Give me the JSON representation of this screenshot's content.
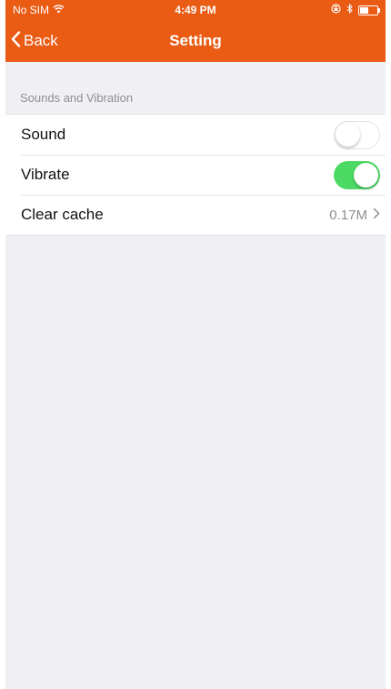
{
  "status_bar": {
    "carrier": "No SIM",
    "time": "4:49 PM",
    "icons": [
      "wifi-icon",
      "orientation-lock-icon",
      "bluetooth-icon",
      "battery-icon"
    ]
  },
  "nav": {
    "back_label": "Back",
    "title": "Setting"
  },
  "section": {
    "header": "Sounds and Vibration"
  },
  "rows": [
    {
      "label": "Sound",
      "toggle_on": false
    },
    {
      "label": "Vibrate",
      "toggle_on": true
    },
    {
      "label": "Clear cache",
      "value": "0.17M"
    }
  ],
  "colors": {
    "brand": "#ea5b14",
    "toggle_on": "#4cd964",
    "background": "#efeff4"
  }
}
